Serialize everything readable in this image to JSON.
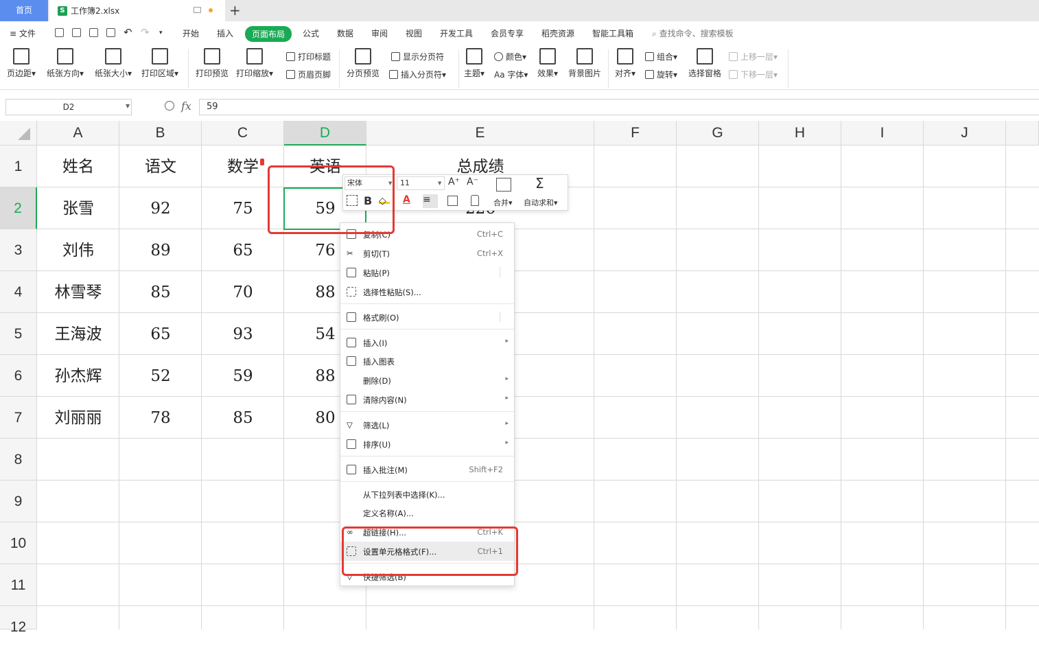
{
  "tabs": {
    "home": "首页",
    "file": "工作簿2.xlsx",
    "new_tab": "+"
  },
  "menu": {
    "file": "≡ 文件",
    "items": [
      "开始",
      "插入",
      "页面布局",
      "公式",
      "数据",
      "审阅",
      "视图",
      "开发工具",
      "会员专享",
      "稻壳资源",
      "智能工具箱"
    ],
    "active_index": 2,
    "search": "查找命令、搜索模板"
  },
  "ribbon": {
    "margins": "页边距",
    "orientation": "纸张方向",
    "size": "纸张大小",
    "print_area": "打印区域",
    "print_preview": "打印预览",
    "print_scale": "打印缩放",
    "print_titles": "打印标题",
    "header_footer": "页眉页脚",
    "page_break_preview": "分页预览",
    "show_breaks": "显示分页符",
    "insert_break": "插入分页符",
    "theme": "主题",
    "colors": "颜色",
    "fonts": "Aa 字体",
    "effects": "效果",
    "background": "背景图片",
    "align": "对齐",
    "group": "组合",
    "rotate": "旋转",
    "selection_pane": "选择窗格",
    "bring_forward": "上移一层",
    "send_backward": "下移一层"
  },
  "formula": {
    "name_box": "D2",
    "fx": "fx",
    "value": "59"
  },
  "columns": [
    "A",
    "B",
    "C",
    "D",
    "E",
    "F",
    "G",
    "H",
    "I",
    "J"
  ],
  "rows": [
    "1",
    "2",
    "3",
    "4",
    "5",
    "6",
    "7",
    "8",
    "9",
    "10",
    "11",
    "12"
  ],
  "table": {
    "headers": [
      "姓名",
      "语文",
      "数学",
      "英语",
      "总成绩"
    ],
    "data": [
      [
        "张雪",
        "92",
        "75",
        "59",
        "226"
      ],
      [
        "刘伟",
        "89",
        "65",
        "76",
        ""
      ],
      [
        "林雪琴",
        "85",
        "70",
        "88",
        ""
      ],
      [
        "王海波",
        "65",
        "93",
        "54",
        ""
      ],
      [
        "孙杰辉",
        "52",
        "59",
        "88",
        ""
      ],
      [
        "刘丽丽",
        "78",
        "85",
        "80",
        ""
      ]
    ]
  },
  "mini_toolbar": {
    "font": "宋体",
    "size": "11",
    "bold": "B",
    "merge": "合并",
    "autosum": "自动求和"
  },
  "context_menu": [
    {
      "label": "复制(C)",
      "shortcut": "Ctrl+C"
    },
    {
      "label": "剪切(T)",
      "shortcut": "Ctrl+X"
    },
    {
      "label": "粘贴(P)",
      "shortcut": ""
    },
    {
      "label": "选择性粘贴(S)...",
      "shortcut": ""
    },
    {
      "label": "格式刷(O)",
      "shortcut": ""
    },
    {
      "label": "插入(I)",
      "shortcut": ""
    },
    {
      "label": "插入图表",
      "shortcut": ""
    },
    {
      "label": "删除(D)",
      "shortcut": ""
    },
    {
      "label": "清除内容(N)",
      "shortcut": ""
    },
    {
      "label": "筛选(L)",
      "shortcut": ""
    },
    {
      "label": "排序(U)",
      "shortcut": ""
    },
    {
      "label": "插入批注(M)",
      "shortcut": "Shift+F2"
    },
    {
      "label": "从下拉列表中选择(K)...",
      "shortcut": ""
    },
    {
      "label": "定义名称(A)...",
      "shortcut": ""
    },
    {
      "label": "超链接(H)...",
      "shortcut": "Ctrl+K"
    },
    {
      "label": "设置单元格格式(F)...",
      "shortcut": "Ctrl+1"
    },
    {
      "label": "快捷筛选(B)",
      "shortcut": ""
    }
  ],
  "colors": {
    "accent": "#1aaa55",
    "highlight": "#e53935",
    "tab_home": "#5b8def"
  }
}
